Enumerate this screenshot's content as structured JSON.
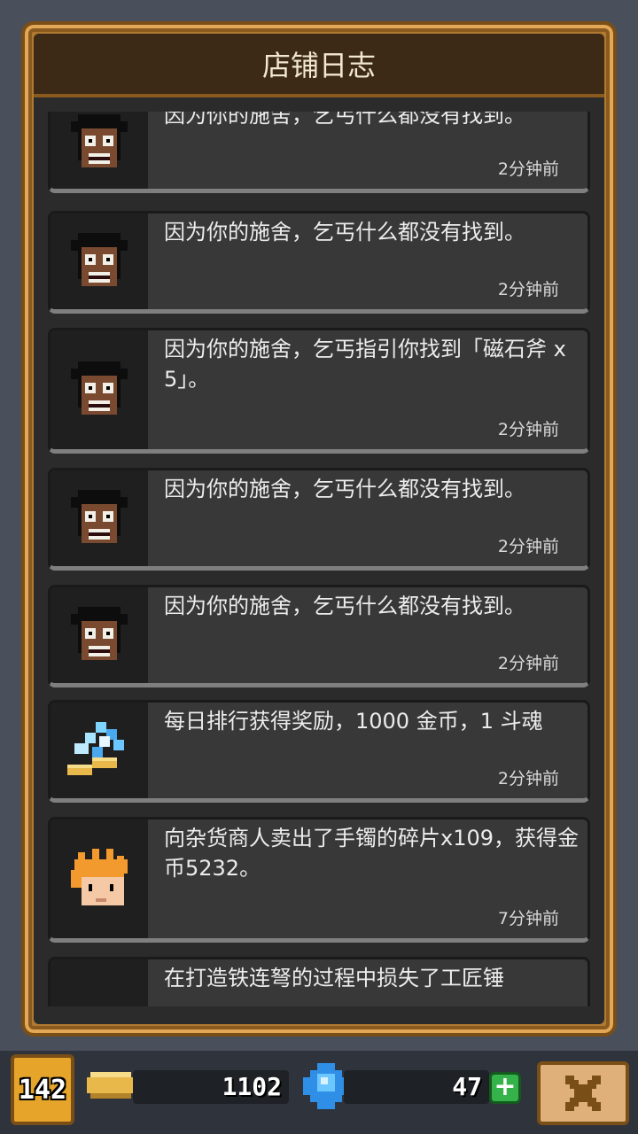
{
  "header": {
    "title": "店铺日志"
  },
  "entries": [
    {
      "icon": "beggar-icon",
      "message": "因为你的施舍，乞丐什么都没有找到。",
      "time": "2分钟前"
    },
    {
      "icon": "beggar-icon",
      "message": "因为你的施舍，乞丐什么都没有找到。",
      "time": "2分钟前"
    },
    {
      "icon": "beggar-icon",
      "message": "因为你的施舍，乞丐指引你找到「磁石斧 x 5」。",
      "time": "2分钟前"
    },
    {
      "icon": "beggar-icon",
      "message": "因为你的施舍，乞丐什么都没有找到。",
      "time": "2分钟前"
    },
    {
      "icon": "beggar-icon",
      "message": "因为你的施舍，乞丐什么都没有找到。",
      "time": "2分钟前"
    },
    {
      "icon": "gems-coins-icon",
      "message": "每日排行获得奖励，1000 金币，1 斗魂",
      "time": "2分钟前"
    },
    {
      "icon": "merchant-icon",
      "message": "向杂货商人卖出了手镯的碎片x109，获得金币5232。",
      "time": "7分钟前"
    },
    {
      "icon": "merchant-icon",
      "message": "在打造铁连弩的过程中损失了工匠锤",
      "time": ""
    }
  ],
  "status_bar": {
    "level": "142",
    "gold": "1102",
    "gems": "47"
  },
  "colors": {
    "frame_gold": "#b07a32",
    "panel_bg": "#2b2b2b",
    "entry_bg": "#383838",
    "plus_green": "#36b24a"
  }
}
